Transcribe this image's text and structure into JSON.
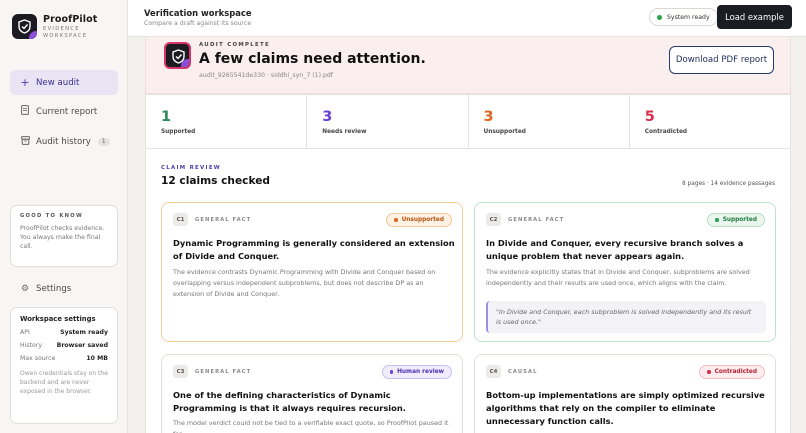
{
  "app": {
    "name": "ProofPilot",
    "subtitle": "EVIDENCE WORKSPACE"
  },
  "sidebar": {
    "nav": [
      {
        "label": "New audit",
        "icon": "plus-icon"
      },
      {
        "label": "Current report",
        "icon": "document-icon"
      },
      {
        "label": "Audit history",
        "icon": "archive-icon",
        "count": "1"
      }
    ],
    "good_to_know": {
      "title": "GOOD TO KNOW",
      "body": "ProofPilot checks evidence. You always make the final call."
    },
    "settings": {
      "label": "Settings",
      "icon": "gear-icon"
    },
    "workspace": {
      "title": "Workspace settings",
      "rows": [
        {
          "key": "API",
          "value": "System ready"
        },
        {
          "key": "History",
          "value": "Browser saved"
        },
        {
          "key": "Max source",
          "value": "10 MB"
        }
      ],
      "note": "Owen credentials stay on the backend and are never exposed in the browser."
    }
  },
  "topbar": {
    "title": "Verification workspace",
    "subtitle": "Compare a draft against its source",
    "status": "System ready",
    "load_button": "Load example"
  },
  "banner": {
    "kicker": "AUDIT COMPLETE",
    "title": "A few claims need attention.",
    "file": "audit_9265541de330 · siddhi_syn_7 (1).pdf",
    "download_button": "Download PDF report"
  },
  "stats": [
    {
      "value": "1",
      "label": "Supported",
      "color": "#2e8b57"
    },
    {
      "value": "3",
      "label": "Needs review",
      "color": "#6a3fd6"
    },
    {
      "value": "3",
      "label": "Unsupported",
      "color": "#e0661f"
    },
    {
      "value": "5",
      "label": "Contradicted",
      "color": "#d8304a"
    }
  ],
  "review": {
    "kicker": "CLAIM REVIEW",
    "title": "12 claims checked",
    "meta": "8 pages · 14 evidence passages"
  },
  "claims": [
    {
      "id": "C1",
      "type": "GENERAL FACT",
      "status": "Unsupported",
      "text": "Dynamic Programming is generally considered an extension of Divide and Conquer.",
      "explanation": "The evidence contrasts Dynamic Programming with Divide and Conquer based on overlapping versus independent subproblems, but does not describe DP as an extension of Divide and Conquer.",
      "quote": ""
    },
    {
      "id": "C2",
      "type": "GENERAL FACT",
      "status": "Supported",
      "text": "In Divide and Conquer, every recursive branch solves a unique problem that never appears again.",
      "explanation": "The evidence explicitly states that in Divide and Conquer, subproblems are solved independently and their results are used once, which aligns with the claim.",
      "quote": "\"In Divide and Conquer, each subproblem is solved independently and its result is used once.\""
    },
    {
      "id": "C3",
      "type": "GENERAL FACT",
      "status": "Human review",
      "text": "One of the defining characteristics of Dynamic Programming is that it always requires recursion.",
      "explanation": "The model verdict could not be tied to a verifiable exact quote, so ProofPilot paused it for",
      "quote": ""
    },
    {
      "id": "C4",
      "type": "CAUSAL",
      "status": "Contradicted",
      "text": "Bottom-up implementations are simply optimized recursive algorithms that rely on the compiler to eliminate unnecessary function calls.",
      "explanation": "",
      "quote": ""
    }
  ],
  "colors": {
    "unsupported": "#e0661f",
    "supported": "#2aa24e",
    "human_review": "#6a3fd6",
    "contradicted": "#d8304a"
  }
}
